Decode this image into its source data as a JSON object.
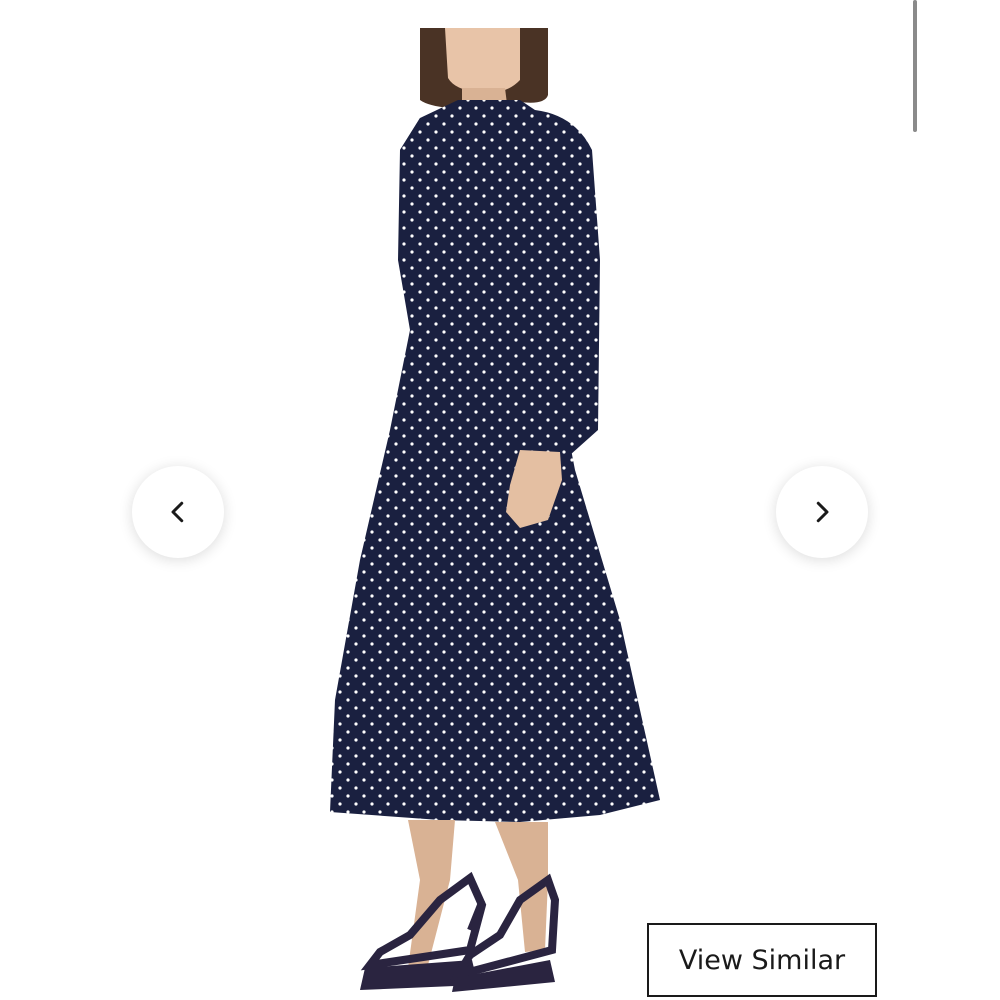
{
  "viewer": {
    "prev_icon": "chevron-left-icon",
    "next_icon": "chevron-right-icon",
    "view_similar_label": "View Similar"
  },
  "colors": {
    "dress": "#1a2040",
    "dots": "#ffffff",
    "skin": "#e8c4a8",
    "hair": "#4a3325",
    "sandal": "#2a2440"
  }
}
